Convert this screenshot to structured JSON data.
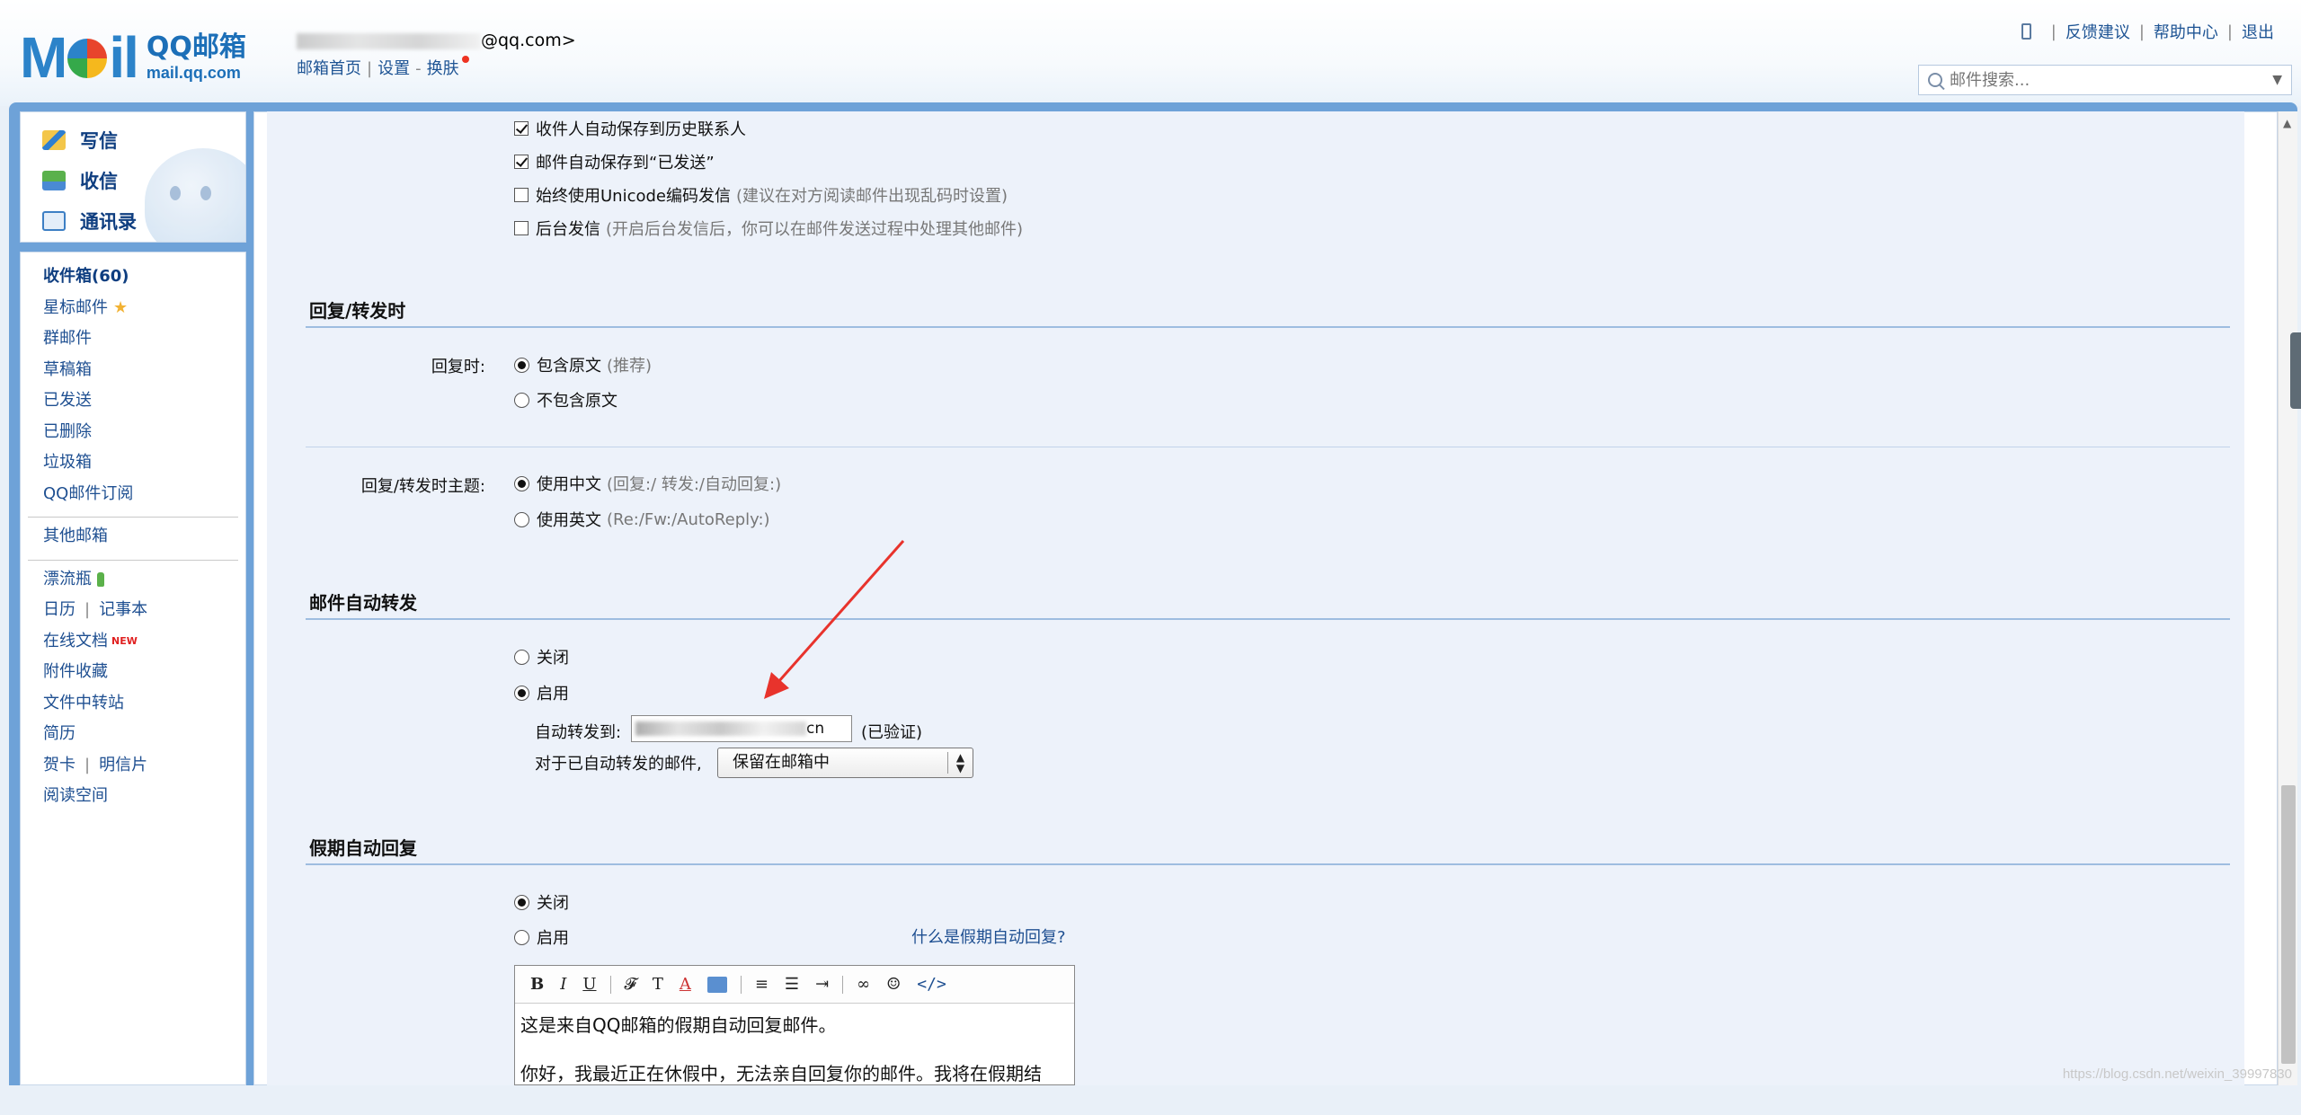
{
  "header": {
    "logo_text_left": "M",
    "logo_text_right": "il",
    "brand_cn": "QQ邮箱",
    "brand_en": "mail.qq.com",
    "email_suffix": "@qq.com>",
    "links": [
      "邮箱首页",
      "设置",
      "换肤"
    ],
    "top_links": [
      "反馈建议",
      "帮助中心",
      "退出"
    ],
    "search_placeholder": "邮件搜索..."
  },
  "quick": [
    {
      "label": "写信",
      "icon": "write-icon"
    },
    {
      "label": "收信",
      "icon": "receive-icon"
    },
    {
      "label": "通讯录",
      "icon": "contacts-icon"
    }
  ],
  "sidebar": {
    "inbox": "收件箱(60)",
    "starred": "星标邮件",
    "group": "群邮件",
    "drafts": "草稿箱",
    "sent": "已发送",
    "deleted": "已删除",
    "trash": "垃圾箱",
    "subscribe": "QQ邮件订阅",
    "other": "其他邮箱",
    "bottle": "漂流瓶",
    "calendar": "日历",
    "notes": "记事本",
    "docs": "在线文档",
    "docs_badge": "NEW",
    "attach": "附件收藏",
    "transfer": "文件中转站",
    "resume": "简历",
    "card": "贺卡",
    "postcard": "明信片",
    "reading": "阅读空间"
  },
  "send_options": [
    {
      "label": "收件人自动保存到历史联系人",
      "checked": true,
      "hint": ""
    },
    {
      "label": "邮件自动保存到“已发送”",
      "checked": true,
      "hint": ""
    },
    {
      "label": "始终使用Unicode编码发信",
      "checked": false,
      "hint": "(建议在对方阅读邮件出现乱码时设置)"
    },
    {
      "label": "后台发信",
      "checked": false,
      "hint": "(开启后台发信后，你可以在邮件发送过程中处理其他邮件)"
    }
  ],
  "reply_section": {
    "title": "回复/转发时",
    "reply_label": "回复时:",
    "opt1": "包含原文",
    "opt1_hint": "(推荐)",
    "opt2": "不包含原文",
    "subject_label": "回复/转发时主题:",
    "opt3": "使用中文",
    "opt3_hint": "(回复:/ 转发:/自动回复:)",
    "opt4": "使用英文",
    "opt4_hint": "(Re:/Fw:/AutoReply:)"
  },
  "forward_section": {
    "title": "邮件自动转发",
    "off": "关闭",
    "on": "启用",
    "to_label": "自动转发到:",
    "to_value_tail": "cn",
    "verified": "(已验证)",
    "after_label": "对于已自动转发的邮件,",
    "after_value": "保留在邮箱中"
  },
  "vacation_section": {
    "title": "假期自动回复",
    "off": "关闭",
    "on": "启用",
    "help_link": "什么是假期自动回复?",
    "body_line1": "这是来自QQ邮箱的假期自动回复邮件。",
    "body_line2": "你好，我最近正在休假中，无法亲自回复你的邮件。我将在假期结"
  },
  "watermark": "https://blog.csdn.net/weixin_39997830"
}
